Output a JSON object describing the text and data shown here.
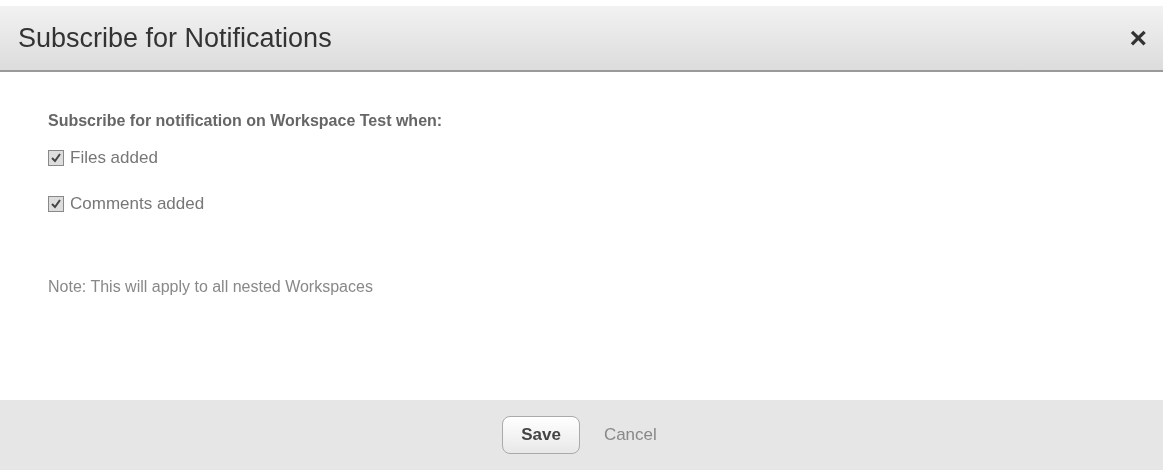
{
  "dialog": {
    "title": "Subscribe for Notifications",
    "close": "×"
  },
  "prompt": "Subscribe for notification on Workspace Test when:",
  "options": [
    {
      "label": "Files added",
      "checked": true
    },
    {
      "label": "Comments added",
      "checked": true
    }
  ],
  "note": "Note: This will apply to all nested Workspaces",
  "buttons": [
    {
      "kind": "primary",
      "label": "Save"
    },
    {
      "kind": "link",
      "label": "Cancel"
    }
  ]
}
